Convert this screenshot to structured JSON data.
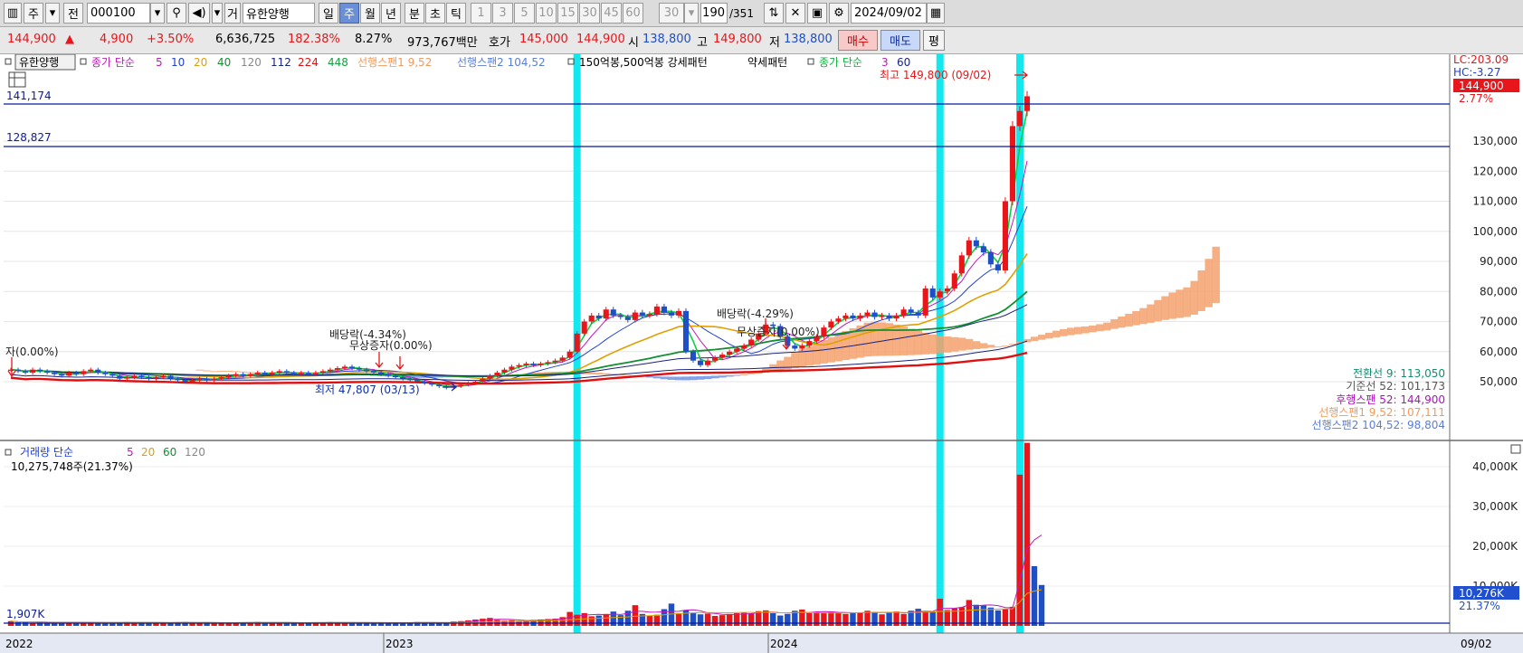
{
  "toolbar": {
    "period_main": "주",
    "prev": "전",
    "code": "000100",
    "name_prefix": "거",
    "stock_name": "유한양행",
    "tabs": [
      "일",
      "주",
      "월",
      "년",
      "분",
      "초",
      "틱"
    ],
    "selected_tab": "주",
    "counts": [
      "1",
      "3",
      "5",
      "10",
      "15",
      "30",
      "45",
      "60"
    ],
    "count_box": "30",
    "range_current": "190",
    "range_total": "/351",
    "date": "2024/09/02"
  },
  "quote": {
    "price": "144,900",
    "change": "4,900",
    "change_pct": "+3.50%",
    "volume": "6,636,725",
    "vol_ratio": "182.38%",
    "turnover": "8.27%",
    "amount": "973,767백만",
    "ask_label": "호가",
    "ask": "145,000",
    "bid": "144,900",
    "open_label": "시",
    "open": "138,800",
    "high_label": "고",
    "high": "149,800",
    "low_label": "저",
    "low": "138,800",
    "buy": "매수",
    "sell": "매도",
    "eval": "평"
  },
  "legend": {
    "name": "유한양행",
    "ma_label": "종가 단순",
    "ma_periods": [
      "5",
      "10",
      "20",
      "40",
      "120",
      "112",
      "224",
      "448"
    ],
    "span1": "선행스팬1 9,52",
    "span2": "선행스팬2 104,52",
    "pattern": "150억봉,500억봉 강세패턴",
    "pattern2": "약세패턴",
    "ma2_label": "종가 단순",
    "ma2_periods": [
      "3",
      "60"
    ]
  },
  "annotations": {
    "high": "최고 149,800 (09/02)",
    "low": "최저 47,807 (03/13)",
    "div1": "배당락(-4.34%)",
    "bonus1": "무상증자(0.00%)",
    "div2": "배당락(-4.29%)",
    "bonus2": "무상증자(0.00%)",
    "bonus0": "자(0.00%)",
    "hline1": "141,174",
    "hline2": "128,827"
  },
  "right_info": {
    "lc": "LC:203.09",
    "hc": "HC:-3.27",
    "price": "144,900",
    "pct": "2.77%"
  },
  "ichimoku": {
    "conv": "전환선 9: 113,050",
    "base": "기준선 52: 101,173",
    "lag": "후행스팬 52: 144,900",
    "lead1": "선행스팬1 9,52: 107,111",
    "lead2": "선행스팬2 104,52: 98,804"
  },
  "volume_panel": {
    "legend_label": "거래량 단순",
    "periods": [
      "5",
      "20",
      "60",
      "120"
    ],
    "current": "10,275,748주(21.37%)",
    "hline": "1,907K",
    "right_value": "10,276K",
    "right_pct": "21.37%"
  },
  "x_axis": {
    "labels": [
      "2022",
      "2023",
      "2024"
    ],
    "end_label": "09/02"
  },
  "colors": {
    "up": "#e8161a",
    "down": "#1f4fc7",
    "cloud_pos": "#f4a16c",
    "cloud_neg": "#6f93e8",
    "highlight": "#12e8ee",
    "hline": "#0b1b9a"
  },
  "chart_data": [
    {
      "type": "candlestick",
      "x_unit": "week",
      "y_ticks": [
        50000,
        60000,
        70000,
        80000,
        90000,
        100000,
        110000,
        120000,
        130000
      ],
      "highest": 149800,
      "lowest": 47807,
      "last": 144900,
      "series": [
        {
          "name": "close",
          "values": [
            54000,
            53500,
            53000,
            54000,
            53500,
            53000,
            52500,
            52000,
            53000,
            52500,
            53500,
            54000,
            53000,
            52500,
            52000,
            51000,
            51500,
            52000,
            51500,
            51000,
            51500,
            52000,
            51000,
            50500,
            50000,
            50500,
            51000,
            50500,
            51000,
            51500,
            52000,
            52500,
            52000,
            52500,
            53000,
            52500,
            53000,
            53500,
            53000,
            52500,
            53000,
            52500,
            53000,
            53500,
            54000,
            54500,
            55000,
            54500,
            54000,
            53500,
            53000,
            52500,
            52000,
            51500,
            51000,
            50500,
            50000,
            49500,
            49000,
            48500,
            48000,
            48500,
            49000,
            49500,
            50000,
            51000,
            52000,
            53000,
            54000,
            55000,
            55500,
            56000,
            55500,
            56000,
            56500,
            57000,
            58000,
            60000,
            66000,
            70000,
            72000,
            71000,
            74000,
            72000,
            71500,
            70500,
            73000,
            72000,
            72500,
            75000,
            73000,
            72000,
            73500,
            60000,
            57000,
            55500,
            57000,
            58000,
            59000,
            60000,
            61000,
            62000,
            64000,
            66000,
            69000,
            68500,
            65000,
            62000,
            61000,
            62000,
            63500,
            65000,
            68000,
            70000,
            71000,
            72000,
            71000,
            72000,
            73000,
            71500,
            72000,
            71000,
            72000,
            74000,
            73000,
            72000,
            81000,
            78000,
            80000,
            81000,
            86000,
            92000,
            97000,
            95000,
            93000,
            89000,
            87000,
            110000,
            135000,
            140000,
            144900
          ]
        }
      ]
    },
    {
      "type": "bar",
      "x_unit": "week",
      "y_ticks": [
        10000,
        20000,
        30000,
        40000
      ],
      "y_unit": "K",
      "series": [
        {
          "name": "거래량",
          "values": [
            1200,
            900,
            1000,
            800,
            1100,
            900,
            700,
            800,
            900,
            1000,
            850,
            900,
            800,
            700,
            800,
            900,
            1000,
            800,
            700,
            900,
            850,
            800,
            700,
            900,
            1000,
            800,
            700,
            750,
            800,
            900,
            850,
            700,
            800,
            900,
            1000,
            850,
            800,
            700,
            900,
            800,
            750,
            800,
            850,
            900,
            950,
            800,
            700,
            800,
            850,
            900,
            800,
            700,
            750,
            800,
            850,
            900,
            950,
            800,
            700,
            750,
            900,
            1100,
            1200,
            1400,
            1600,
            1800,
            2000,
            1500,
            1300,
            1400,
            1200,
            1300,
            1500,
            1600,
            1700,
            1800,
            2200,
            3500,
            2800,
            3200,
            2400,
            2600,
            3000,
            3600,
            2700,
            3800,
            5200,
            3000,
            2500,
            2800,
            4200,
            5600,
            3200,
            4000,
            3200,
            2900,
            3100,
            2500,
            2700,
            3000,
            3200,
            3400,
            3100,
            3700,
            3900,
            3200,
            2600,
            3000,
            3800,
            4100,
            3200,
            3500,
            3300,
            3600,
            3400,
            3000,
            3200,
            3300,
            3800,
            3500,
            2900,
            3400,
            3600,
            3000,
            3800,
            4300,
            3600,
            3400,
            6800,
            4000,
            4400,
            4700,
            6500,
            5300,
            5100,
            4600,
            3900,
            4200,
            4800,
            38000,
            46000,
            15000,
            10276
          ]
        }
      ]
    }
  ]
}
